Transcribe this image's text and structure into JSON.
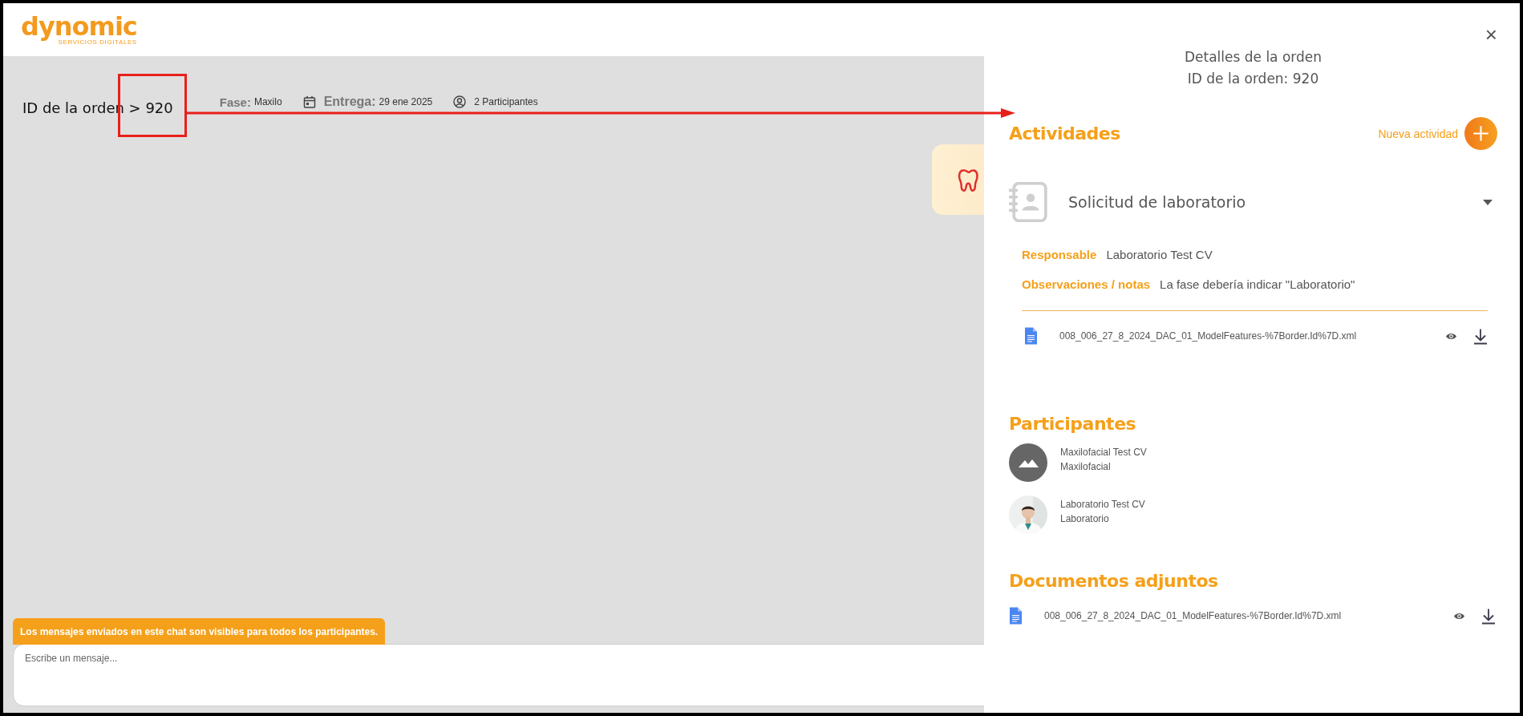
{
  "header": {
    "logo": {
      "name": "dynomic",
      "tagline": "SERVICIOS DIGITALES"
    }
  },
  "order_bar": {
    "title": "ID de la orden > 920",
    "phase_label": "Fase:",
    "phase": "Maxilo",
    "delivery_label": "Entrega:",
    "delivery": "29 ene 2025",
    "participants": "2 Participantes"
  },
  "chat": {
    "notice": "Los mensajes enviados en este chat son visibles para todos los participantes.",
    "placeholder": "Escribe un mensaje..."
  },
  "panel": {
    "title": "Detalles de la orden",
    "subtitle": "ID de la orden: 920",
    "close": "×",
    "activities": {
      "heading": "Actividades",
      "new_label": "Nueva actividad",
      "items": [
        {
          "title": "Solicitud de laboratorio",
          "expanded": true,
          "fields": [
            {
              "label": "Responsable",
              "value": "Laboratorio Test CV"
            },
            {
              "label": "Observaciones / notas",
              "value": "La fase debería indicar \"Laboratorio\""
            }
          ],
          "files": [
            {
              "name": "008_006_27_8_2024_DAC_01_ModelFeatures-%7Border.Id%7D.xml"
            }
          ]
        }
      ]
    },
    "participants": {
      "heading": "Participantes",
      "items": [
        {
          "name": "Maxilofacial Test CV",
          "role": "Maxilofacial",
          "kind": "placeholder"
        },
        {
          "name": "Laboratorio Test CV",
          "role": "Laboratorio",
          "kind": "picture"
        }
      ]
    },
    "documents": {
      "heading": "Documentos adjuntos",
      "files": [
        {
          "name": "008_006_27_8_2024_DAC_01_ModelFeatures-%7Border.Id%7D.xml"
        }
      ]
    }
  }
}
